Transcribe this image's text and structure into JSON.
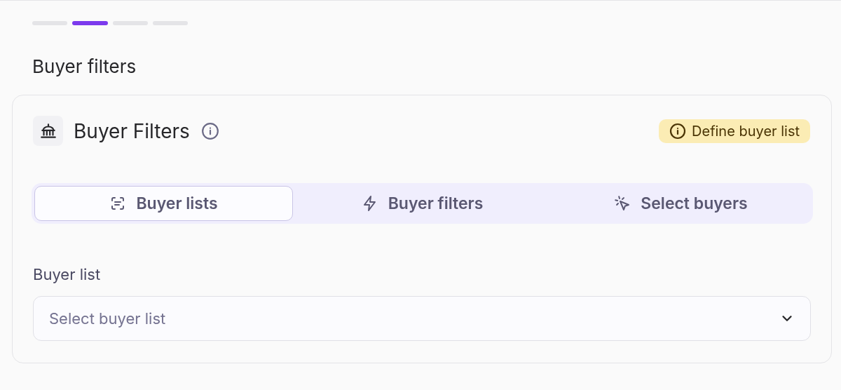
{
  "steps": [
    {
      "selected": false
    },
    {
      "selected": true
    },
    {
      "selected": false
    },
    {
      "selected": false
    }
  ],
  "page_title": "Buyer filters",
  "card": {
    "title": "Buyer Filters",
    "badge": "Define buyer list",
    "tabs": [
      {
        "label": "Buyer lists",
        "kind": "list",
        "selected": true
      },
      {
        "label": "Buyer filters",
        "kind": "bolt",
        "selected": false
      },
      {
        "label": "Select buyers",
        "kind": "pointer",
        "selected": false
      }
    ],
    "field": {
      "label": "Buyer list",
      "placeholder": "Select buyer list"
    }
  }
}
